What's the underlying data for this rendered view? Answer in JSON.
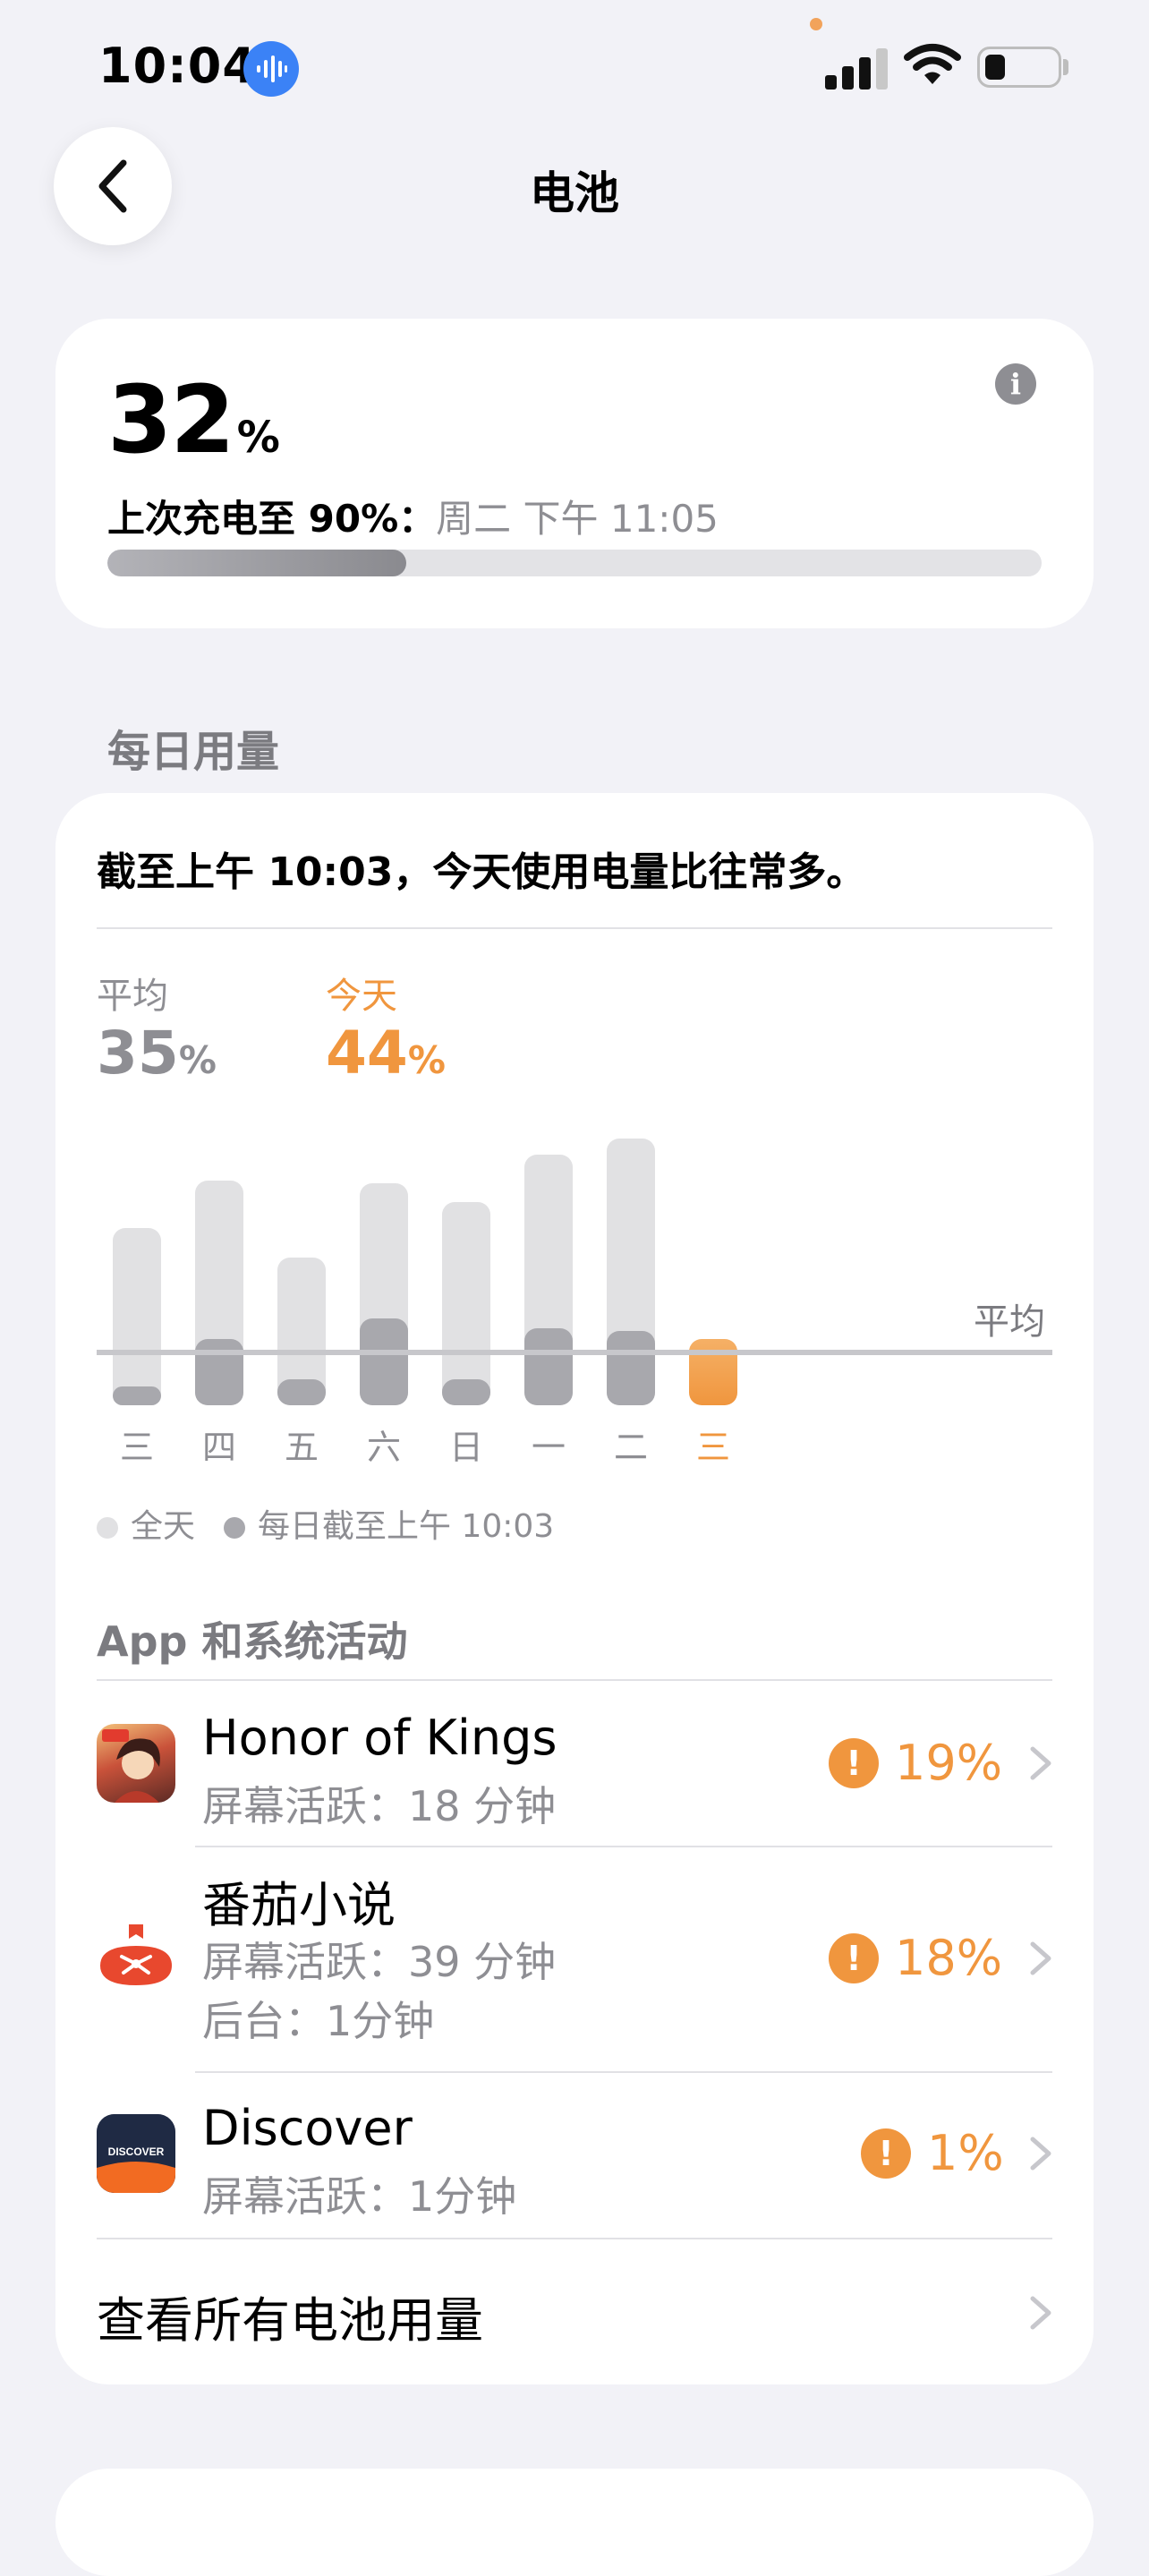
{
  "status_bar": {
    "time": "10:04"
  },
  "nav": {
    "title": "电池"
  },
  "battery": {
    "percent": "32",
    "percent_sign": "%",
    "last_charge_label": "上次充电至 90%：",
    "last_charge_time": "周二 下午 11:05",
    "level_fraction": 0.32,
    "info_glyph": "i"
  },
  "daily": {
    "section_title": "每日用量",
    "summary": "截至上午 10:03，今天使用电量比往常多。",
    "average_label": "平均",
    "average_value": "35",
    "today_label": "今天",
    "today_value": "44",
    "percent_sign": "%",
    "avg_line_label": "平均",
    "legend_all_day": "全天",
    "legend_until": "每日截至上午 10:03"
  },
  "chart_data": {
    "type": "bar",
    "categories": [
      "三",
      "四",
      "五",
      "六",
      "日",
      "一",
      "二",
      "三"
    ],
    "series": [
      {
        "name": "全天",
        "values": [
          67,
          85,
          56,
          84,
          77,
          95,
          101,
          null
        ]
      },
      {
        "name": "每日截至上午 10:03",
        "values": [
          7,
          25,
          10,
          33,
          10,
          29,
          28,
          25
        ]
      }
    ],
    "highlight_index": 7,
    "average_reference": 21,
    "grid": false,
    "legend_position": "bottom"
  },
  "apps": {
    "section_title": "App 和系统活动",
    "items": [
      {
        "name": "Honor of Kings",
        "lines": [
          "屏幕活跃：18 分钟"
        ],
        "percent": "19%"
      },
      {
        "name": "番茄小说",
        "lines": [
          "屏幕活跃：39 分钟",
          "后台：1分钟"
        ],
        "percent": "18%"
      },
      {
        "name": "Discover",
        "lines": [
          "屏幕活跃：1分钟"
        ],
        "percent": "1%"
      }
    ],
    "see_all": "查看所有电池用量",
    "discover_logo_text": "DISCOVER"
  },
  "colors": {
    "accent_orange": "#f0963e",
    "background": "#f2f2f7",
    "card": "#ffffff",
    "secondary_text": "#8e8e93"
  }
}
